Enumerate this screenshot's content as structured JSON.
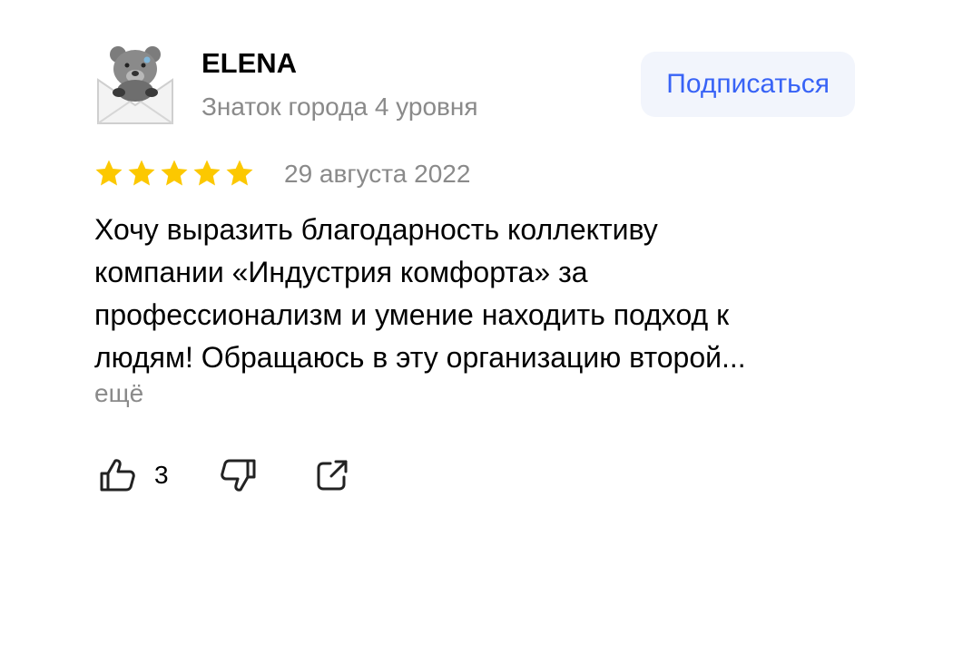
{
  "review": {
    "author": {
      "name": "ELENA",
      "level": "Знаток города 4 уровня"
    },
    "subscribe_label": "Подписаться",
    "rating": 5,
    "date": "29 августа 2022",
    "text_lines": [
      "Хочу выразить благодарность коллективу",
      "компании «Индустрия комфорта» за",
      "профессионализм и умение находить подход к",
      "людям! Обращаюсь в эту организацию второй..."
    ],
    "more_label": "ещё",
    "likes": "3"
  },
  "icons": {
    "avatar": "teddy-bear-envelope-avatar",
    "star": "star-icon",
    "like": "thumbs-up-icon",
    "dislike": "thumbs-down-icon",
    "share": "share-icon"
  },
  "colors": {
    "star": "#fcc800",
    "accent": "#3863f6",
    "button_bg": "#f2f5fc",
    "muted_text": "#8a8a8a"
  }
}
